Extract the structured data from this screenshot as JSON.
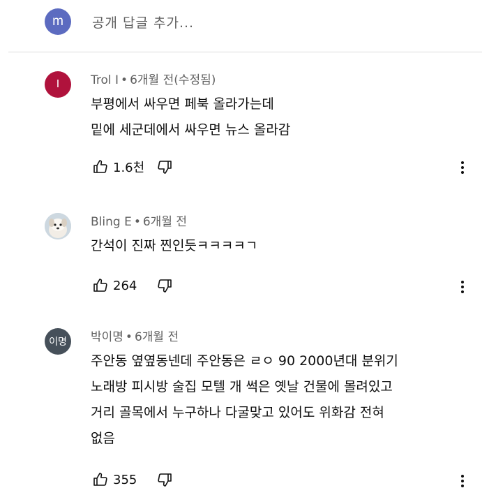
{
  "reply_box": {
    "avatar_letter": "m",
    "placeholder": "공개 답글 추가..."
  },
  "comments": [
    {
      "avatar_letter": "I",
      "author": "Trol I",
      "time": "6개월 전(수정됨)",
      "lines": [
        "부평에서 싸우면 페북 올라가는데",
        "밑에 세군데에서 싸우면 뉴스 올라감"
      ],
      "likes": "1.6천"
    },
    {
      "avatar_letter": "",
      "author": "Bling E",
      "time": "6개월 전",
      "lines": [
        "간석이 진짜 찐인듯ㅋㅋㅋㅋㄱ"
      ],
      "likes": "264"
    },
    {
      "avatar_letter": "이명",
      "author": "박이명",
      "time": "6개월 전",
      "lines": [
        "주안동 옆옆동넨데 주안동은 ㄹㅇ 90 2000년대 분위기",
        "노래방 피시방 술집 모텔 개 썩은 옛날 건물에 몰려있고",
        "거리 골목에서 누구하나 다굴맞고 있어도 위화감 전혀",
        "없음"
      ],
      "likes": "355"
    }
  ],
  "colors": {
    "reply_avatar": "#5c6bc0",
    "avatar_1": "#b0123c",
    "avatar_3": "#46505a",
    "meta_text": "#606060"
  },
  "icons": {
    "like": "thumbs-up-icon",
    "dislike": "thumbs-down-icon",
    "menu": "more-vertical-icon"
  }
}
